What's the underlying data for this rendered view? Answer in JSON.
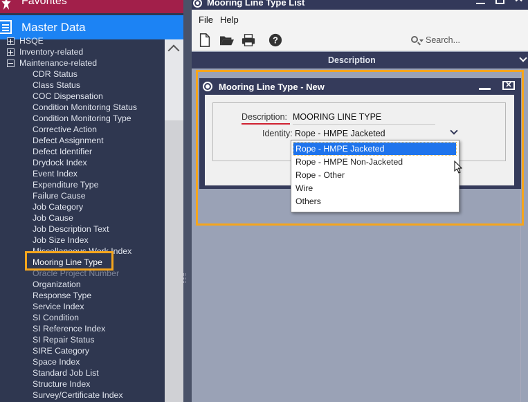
{
  "sidebar": {
    "favorites_label": "Favorites",
    "master_label": "Master Data",
    "tree_nodes": [
      {
        "label": "HSQE",
        "toggle": "plus"
      },
      {
        "label": "Inventory-related",
        "toggle": "plus"
      },
      {
        "label": "Maintenance-related",
        "toggle": "minus"
      }
    ],
    "items": [
      "CDR Status",
      "Class Status",
      "COC Dispensation",
      "Condition Monitoring Status",
      "Condition Monitoring Type",
      "Corrective Action",
      "Defect Assignment",
      "Defect Identifier",
      "Drydock Index",
      "Event Index",
      "Expenditure Type",
      "Failure Cause",
      "Job Category",
      "Job Cause",
      "Job Description Text",
      "Job Size Index",
      "Miscellaneous Work Index",
      "Mooring Line Type",
      "Oracle Project Number",
      "Organization",
      "Response Type",
      "Service Index",
      "SI Condition",
      "SI Reference Index",
      "SI Repair Status",
      "SIRE Category",
      "Space Index",
      "Standard Job List",
      "Structure Index",
      "Survey/Certificate Index"
    ],
    "highlighted_item": "Mooring Line Type"
  },
  "window": {
    "title": "Mooring Line Type List",
    "menu": {
      "file": "File",
      "help": "Help"
    },
    "search_placeholder": "Search...",
    "column_header": "Description"
  },
  "dialog": {
    "title": "Mooring Line Type - New",
    "description_label": "Description:",
    "description_value": "MOORING LINE TYPE",
    "identity_label": "Identity:",
    "identity_value": "Rope - HMPE Jacketed",
    "options": [
      "Rope - HMPE Jacketed",
      "Rope - HMPE Non-Jacketed",
      "Rope - Other",
      "Wire",
      "Others"
    ],
    "selected_option": "Rope - HMPE Jacketed"
  },
  "colors": {
    "sidebar_bg": "#2f3750",
    "favorites_bg": "#a21f4a",
    "master_bg": "#1c83f4",
    "highlight_border": "#f5a51c",
    "selection_bg": "#1f74ec"
  }
}
